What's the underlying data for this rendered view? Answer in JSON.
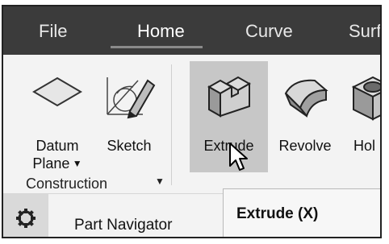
{
  "ribbon": {
    "tabs": [
      {
        "label": "File"
      },
      {
        "label": "Home"
      },
      {
        "label": "Curve"
      },
      {
        "label": "Surf"
      }
    ],
    "active_tab": "Home"
  },
  "construction_group": {
    "buttons": {
      "datum_plane": {
        "label_line1": "Datum",
        "label_line2": "Plane"
      },
      "sketch": {
        "label": "Sketch"
      }
    },
    "group_label": "Construction"
  },
  "feature_group": {
    "buttons": {
      "extrude": {
        "label": "Extrude"
      },
      "revolve": {
        "label": "Revolve"
      },
      "hole": {
        "label": "Hol"
      }
    }
  },
  "bottom": {
    "part_navigator_label": "Part Navigator"
  },
  "tooltip": {
    "title": "Extrude (X)"
  },
  "icons": [
    "datum-plane-icon",
    "sketch-icon",
    "extrude-icon",
    "revolve-icon",
    "hole-icon",
    "gear-icon",
    "mouse-cursor-icon"
  ],
  "colors": {
    "ribbon_bar": "#3b3b3b",
    "ribbon_body": "#f3f3f3",
    "hover_highlight": "#c7c7c7"
  }
}
